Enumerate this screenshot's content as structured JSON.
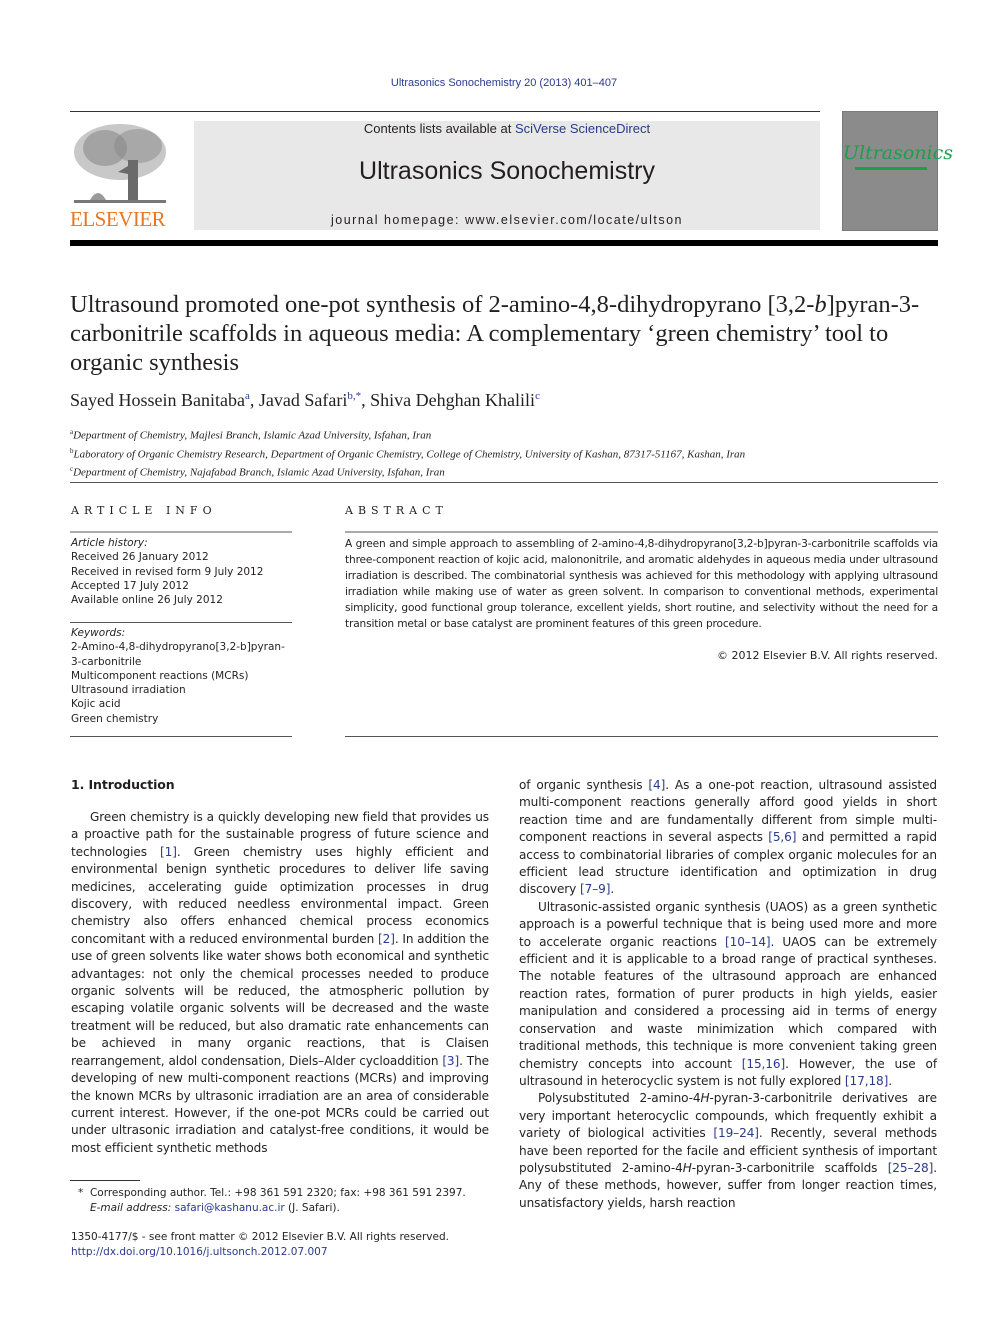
{
  "header": {
    "citation": "Ultrasonics Sonochemistry 20 (2013) 401–407",
    "contents_prefix": "Contents lists available at ",
    "contents_link": "SciVerse ScienceDirect",
    "journal_name": "Ultrasonics Sonochemistry",
    "homepage": "journal homepage: www.elsevier.com/locate/ultson",
    "publisher_logo": "ELSEVIER",
    "cover_title": "Ultrasonics"
  },
  "article": {
    "title": "Ultrasound promoted one-pot synthesis of 2-amino-4,8-dihydropyrano [3,2-b]pyran-3-carbonitrile scaffolds in aqueous media: A complementary ‘green chemistry’ tool to organic synthesis",
    "title_parts": {
      "p1": "Ultrasound promoted one-pot synthesis of 2-amino-4,8-dihydropyrano [3,2-",
      "italic": "b",
      "p2": "]pyran-3-carbonitrile scaffolds in aqueous media: A complementary ‘green chemistry’ tool to organic synthesis"
    },
    "authors": [
      {
        "name": "Sayed Hossein Banitaba",
        "sup": "a"
      },
      {
        "name": "Javad Safari",
        "sup": "b,*"
      },
      {
        "name": "Shiva Dehghan Khalili",
        "sup": "c"
      }
    ],
    "affiliations": [
      {
        "key": "a",
        "text": "Department of Chemistry, Majlesi Branch, Islamic Azad University, Isfahan, Iran"
      },
      {
        "key": "b",
        "text": "Laboratory of Organic Chemistry Research, Department of Organic Chemistry, College of Chemistry, University of Kashan, 87317-51167, Kashan, Iran"
      },
      {
        "key": "c",
        "text": "Department of Chemistry, Najafabad Branch, Islamic Azad University, Isfahan, Iran"
      }
    ]
  },
  "article_info": {
    "heading": "ARTICLE INFO",
    "history_label": "Article history:",
    "history": [
      "Received 26 January 2012",
      "Received in revised form 9 July 2012",
      "Accepted 17 July 2012",
      "Available online 26 July 2012"
    ],
    "keywords_label": "Keywords:",
    "keywords": [
      "2-Amino-4,8-dihydropyrano[3,2-b]pyran-3-carbonitrile",
      "Multicomponent reactions (MCRs)",
      "Ultrasound irradiation",
      "Kojic acid",
      "Green chemistry"
    ]
  },
  "abstract": {
    "heading": "ABSTRACT",
    "text": "A green and simple approach to assembling of 2-amino-4,8-dihydropyrano[3,2-b]pyran-3-carbonitrile scaffolds via three-component reaction of kojic acid, malononitrile, and aromatic aldehydes in aqueous media under ultrasound irradiation is described. The combinatorial synthesis was achieved for this methodology with applying ultrasound irradiation while making use of water as green solvent. In comparison to conventional methods, experimental simplicity, good functional group tolerance, excellent yields, short routine, and selectivity without the need for a transition metal or base catalyst are prominent features of this green procedure.",
    "copyright": "© 2012 Elsevier B.V. All rights reserved."
  },
  "body": {
    "section_heading": "1. Introduction",
    "left_paragraphs": [
      [
        {
          "t": "Green chemistry is a quickly developing new field that provides us a proactive path for the sustainable progress of future science and technologies "
        },
        {
          "ref": "[1]"
        },
        {
          "t": ". Green chemistry uses highly efficient and environmental benign synthetic procedures to deliver life saving medicines, accelerating guide optimization processes in drug discovery, with reduced needless environmental impact. Green chemistry also offers enhanced chemical process economics concomitant with a reduced environmental burden "
        },
        {
          "ref": "[2]"
        },
        {
          "t": ". In addition the use of green solvents like water shows both economical and synthetic advantages: not only the chemical processes needed to produce organic solvents will be reduced, the atmospheric pollution by escaping volatile organic solvents will be decreased and the waste treatment will be reduced, but also dramatic rate enhancements can be achieved in many organic reactions, that is Claisen rearrangement, aldol condensation, Diels–Alder cycloaddition "
        },
        {
          "ref": "[3]"
        },
        {
          "t": ". The developing of new multi-component reactions (MCRs) and improving the known MCRs by ultrasonic irradiation are an area of considerable current interest. However, if the one-pot MCRs could be carried out under ultrasonic irradiation and catalyst-free conditions, it would be most efficient synthetic methods"
        }
      ]
    ],
    "right_paragraphs": [
      [
        {
          "t": "of organic synthesis "
        },
        {
          "ref": "[4]"
        },
        {
          "t": ". As a one-pot reaction, ultrasound assisted multi-component reactions generally afford good yields in short reaction time and are fundamentally different from simple multi-component reactions in several aspects "
        },
        {
          "ref": "[5,6]"
        },
        {
          "t": " and permitted a rapid access to combinatorial libraries of complex organic molecules for an efficient lead structure identification and optimization in drug discovery "
        },
        {
          "ref": "[7–9]"
        },
        {
          "t": "."
        }
      ],
      [
        {
          "t": "Ultrasonic-assisted organic synthesis (UAOS) as a green synthetic approach is a powerful technique that is being used more and more to accelerate organic reactions "
        },
        {
          "ref": "[10–14]"
        },
        {
          "t": ". UAOS can be extremely efficient and it is applicable to a broad range of practical syntheses. The notable features of the ultrasound approach are enhanced reaction rates, formation of purer products in high yields, easier manipulation and considered a processing aid in terms of energy conservation and waste minimization which compared with traditional methods, this technique is more convenient taking green chemistry concepts into account "
        },
        {
          "ref": "[15,16]"
        },
        {
          "t": ". However, the use of ultrasound in heterocyclic system is not fully explored "
        },
        {
          "ref": "[17,18]"
        },
        {
          "t": "."
        }
      ],
      [
        {
          "t": "Polysubstituted 2-amino-4"
        },
        {
          "i": "H"
        },
        {
          "t": "-pyran-3-carbonitrile derivatives are very important heterocyclic compounds, which frequently exhibit a variety of biological activities "
        },
        {
          "ref": "[19–24]"
        },
        {
          "t": ". Recently, several methods have been reported for the facile and efficient synthesis of important polysubstituted 2-amino-4"
        },
        {
          "i": "H"
        },
        {
          "t": "-pyran-3-carbonitrile scaffolds "
        },
        {
          "ref": "[25–28]"
        },
        {
          "t": ". Any of these methods, however, suffer from longer reaction times, unsatisfactory yields, harsh reaction"
        }
      ]
    ]
  },
  "footnote": {
    "marker": "*",
    "corresponding": "Corresponding author. Tel.: +98 361 591 2320; fax: +98 361 591 2397.",
    "email_label": "E-mail address:",
    "email": "safari@kashanu.ac.ir",
    "email_suffix": " (J. Safari)."
  },
  "footer": {
    "issn_line": "1350-4177/$ - see front matter © 2012 Elsevier B.V. All rights reserved.",
    "doi": "http://dx.doi.org/10.1016/j.ultsonch.2012.07.007"
  },
  "colors": {
    "link": "#2b3a8c",
    "elsevier_orange": "#e87722",
    "cover_green": "#1f9e4a",
    "masthead_bg": "#e8e8e8"
  }
}
